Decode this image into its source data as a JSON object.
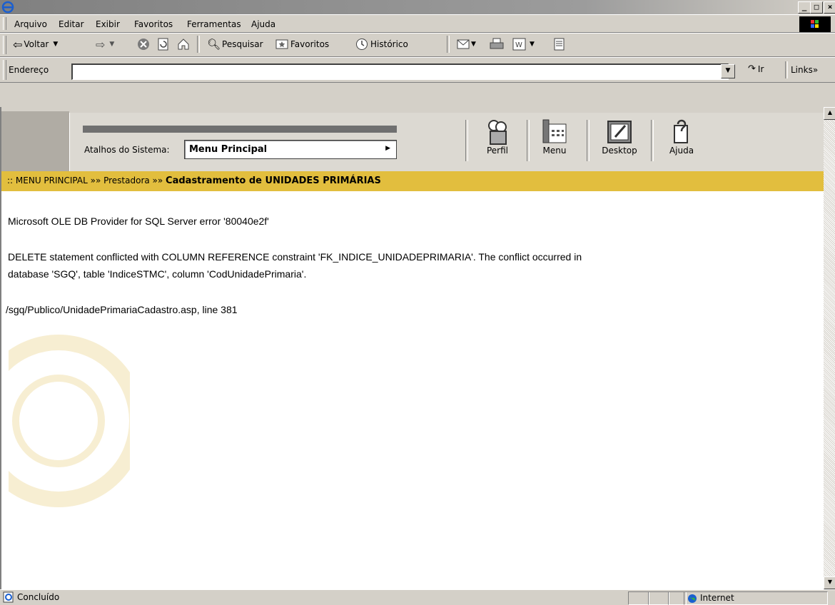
{
  "window": {
    "min_glyph": "_",
    "max_glyph": "□",
    "close_glyph": "×"
  },
  "menu": [
    "Arquivo",
    "Editar",
    "Exibir",
    "Favoritos",
    "Ferramentas",
    "Ajuda"
  ],
  "toolbar": {
    "back": "Voltar",
    "search": "Pesquisar",
    "favorites": "Favoritos",
    "history": "Histórico"
  },
  "address": {
    "label": "Endereço",
    "go": "Ir",
    "links": "Links"
  },
  "header": {
    "shortcut_label": "Atalhos do Sistema:",
    "shortcut_value": "Menu Principal",
    "icons": [
      "Perfil",
      "Menu",
      "Desktop",
      "Ajuda"
    ]
  },
  "breadcrumb": {
    "prefix": ":: MENU PRINCIPAL »» Prestadora  »» ",
    "current": "Cadastramento de UNIDADES PRIMÁRIAS"
  },
  "error": {
    "line1": "Microsoft OLE DB Provider for SQL Server error '80040e2f'",
    "line2": "DELETE statement conflicted with COLUMN REFERENCE constraint 'FK_INDICE_UNIDADEPRIMARIA'. The conflict occurred in",
    "line3": "database 'SGQ', table 'IndiceSTMC', column 'CodUnidadePrimaria'.",
    "line4": "/sgq/Publico/UnidadePrimariaCadastro.asp, line 381"
  },
  "status": {
    "text": "Concluído",
    "zone": "Internet"
  },
  "colors": {
    "breadcrumb_bg": "#e2be3e",
    "titlebar": "#808080"
  }
}
